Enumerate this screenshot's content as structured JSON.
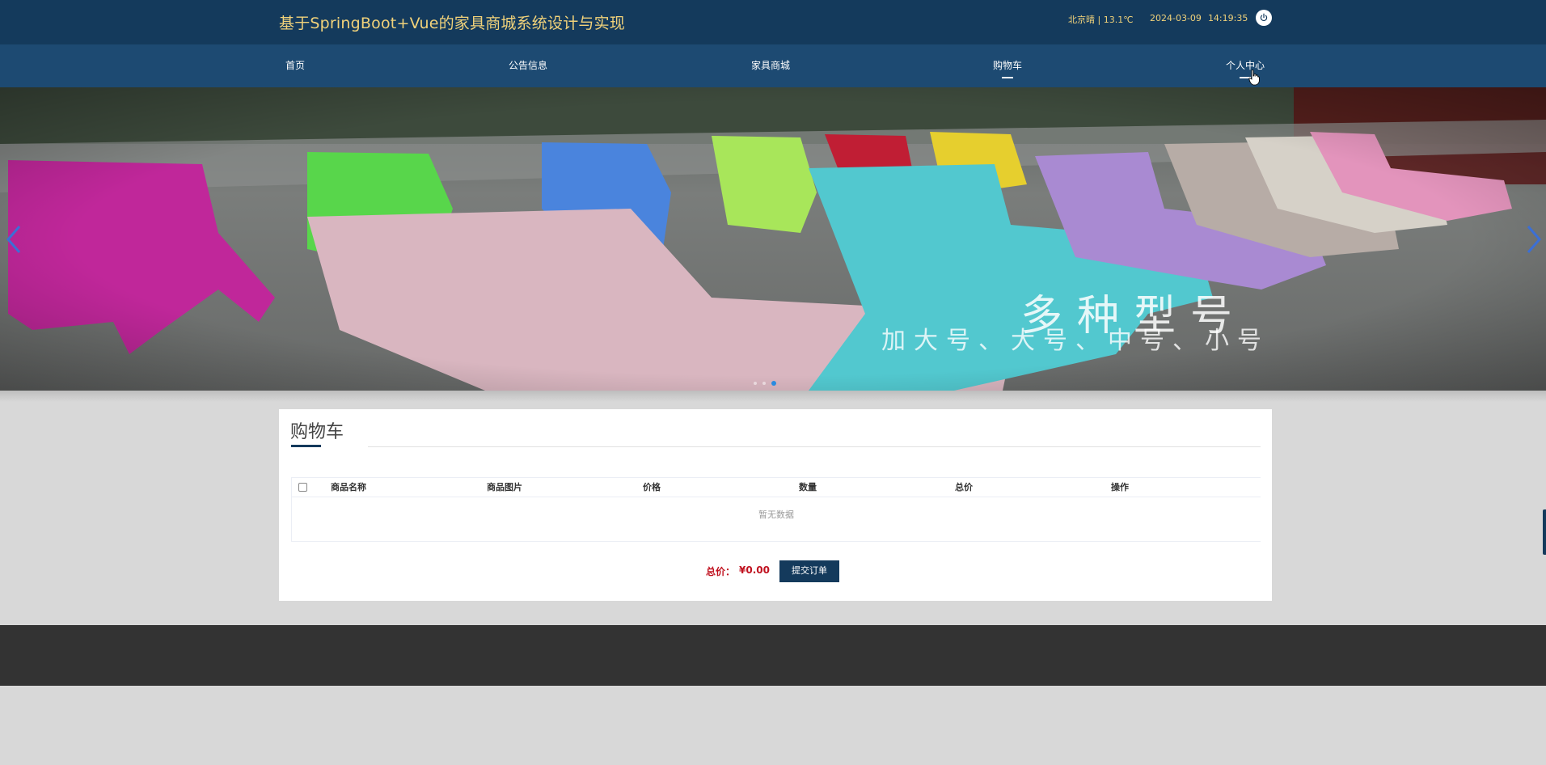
{
  "header": {
    "title": "基于SpringBoot+Vue的家具商城系统设计与实现",
    "weather": "北京晴 | 13.1℃",
    "date": "2024-03-09",
    "time": "14:19:35",
    "power_icon": "power-icon"
  },
  "nav": {
    "items": [
      {
        "label": "首页"
      },
      {
        "label": "公告信息"
      },
      {
        "label": "家具商城"
      },
      {
        "label": "购物车"
      },
      {
        "label": "个人中心"
      }
    ],
    "active_index": 3,
    "hover_index": 4
  },
  "carousel": {
    "caption_main": "多种型号",
    "caption_sub": "加大号、大号、中号、小号",
    "slide_count": 3,
    "active_slide": 3
  },
  "cart": {
    "title": "购物车",
    "columns": [
      "商品名称",
      "商品图片",
      "价格",
      "数量",
      "总价",
      "操作"
    ],
    "empty_text": "暂无数据",
    "total_label": "总价：",
    "total_value": "¥0.00",
    "submit_label": "提交订单"
  },
  "colors": {
    "header_bg": "#143a5c",
    "nav_bg": "#1d4a72",
    "title_gold": "#f1d27a",
    "price_red": "#c0111f",
    "footer_bg": "#333333"
  }
}
